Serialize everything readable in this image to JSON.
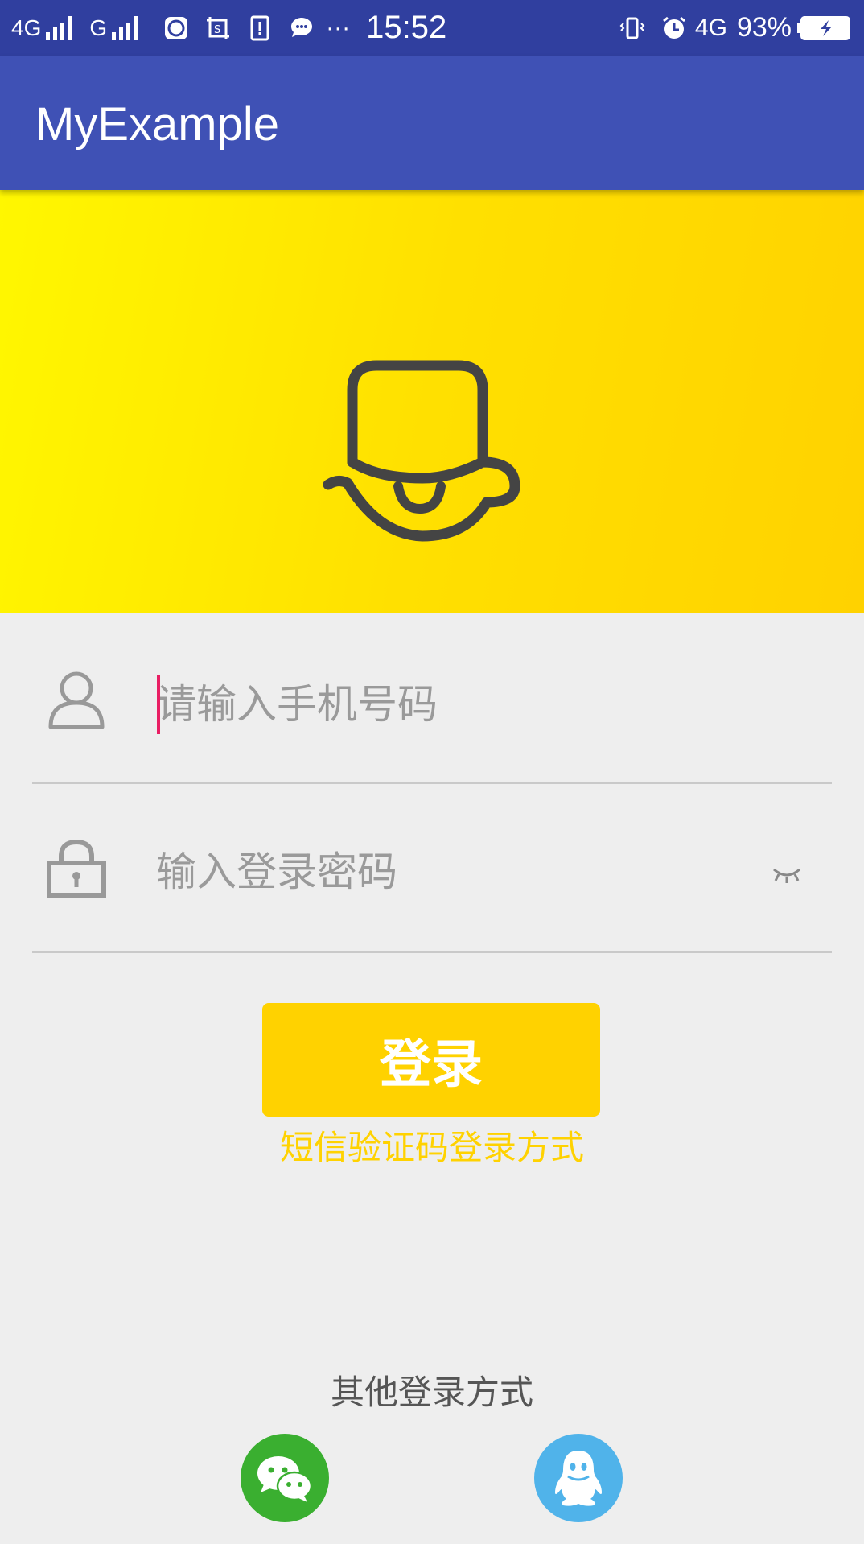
{
  "status_bar": {
    "network1": "4G",
    "network2": "G",
    "network3": "4G",
    "time": "15:52",
    "battery_percent": "93%",
    "more": "···"
  },
  "app_bar": {
    "title": "MyExample"
  },
  "form": {
    "phone_placeholder": "请输入手机号码",
    "password_placeholder": "输入登录密码",
    "login_label": "登录",
    "sms_login_label": "短信验证码登录方式"
  },
  "other_login": {
    "title": "其他登录方式",
    "providers": [
      "wechat",
      "qq"
    ]
  },
  "colors": {
    "status_bar": "#303f9f",
    "app_bar": "#3f51b5",
    "accent_yellow": "#ffd200",
    "cursor": "#e91e63",
    "wechat": "#3aaf30",
    "qq": "#50b3ea"
  },
  "icons": {
    "user": "user-icon",
    "lock": "lock-icon",
    "eye": "eye-closed-icon",
    "wechat": "wechat-icon",
    "qq": "qq-icon",
    "mascot": "mascot-logo"
  }
}
